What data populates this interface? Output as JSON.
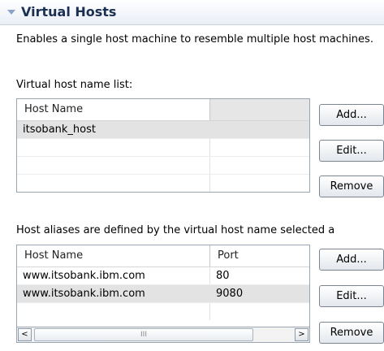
{
  "section": {
    "title": "Virtual Hosts"
  },
  "description": "Enables a single host machine to resemble multiple host machines.",
  "vhost_list": {
    "label": "Virtual host name list:",
    "columns": [
      "Host Name",
      ""
    ],
    "rows": [
      [
        "itsobank_host",
        ""
      ]
    ],
    "buttons": {
      "add": "Add...",
      "edit": "Edit...",
      "remove": "Remove"
    }
  },
  "aliases": {
    "label": "Host aliases are defined by the virtual host name selected a",
    "columns": [
      "Host Name",
      "Port"
    ],
    "rows": [
      [
        "www.itsobank.ibm.com",
        "80"
      ],
      [
        "www.itsobank.ibm.com",
        "9080"
      ]
    ],
    "buttons": {
      "add": "Add...",
      "edit": "Edit...",
      "remove": "Remove"
    }
  },
  "scrollbar": {
    "left_arrow": "<",
    "right_arrow": ">",
    "grip": "III"
  }
}
